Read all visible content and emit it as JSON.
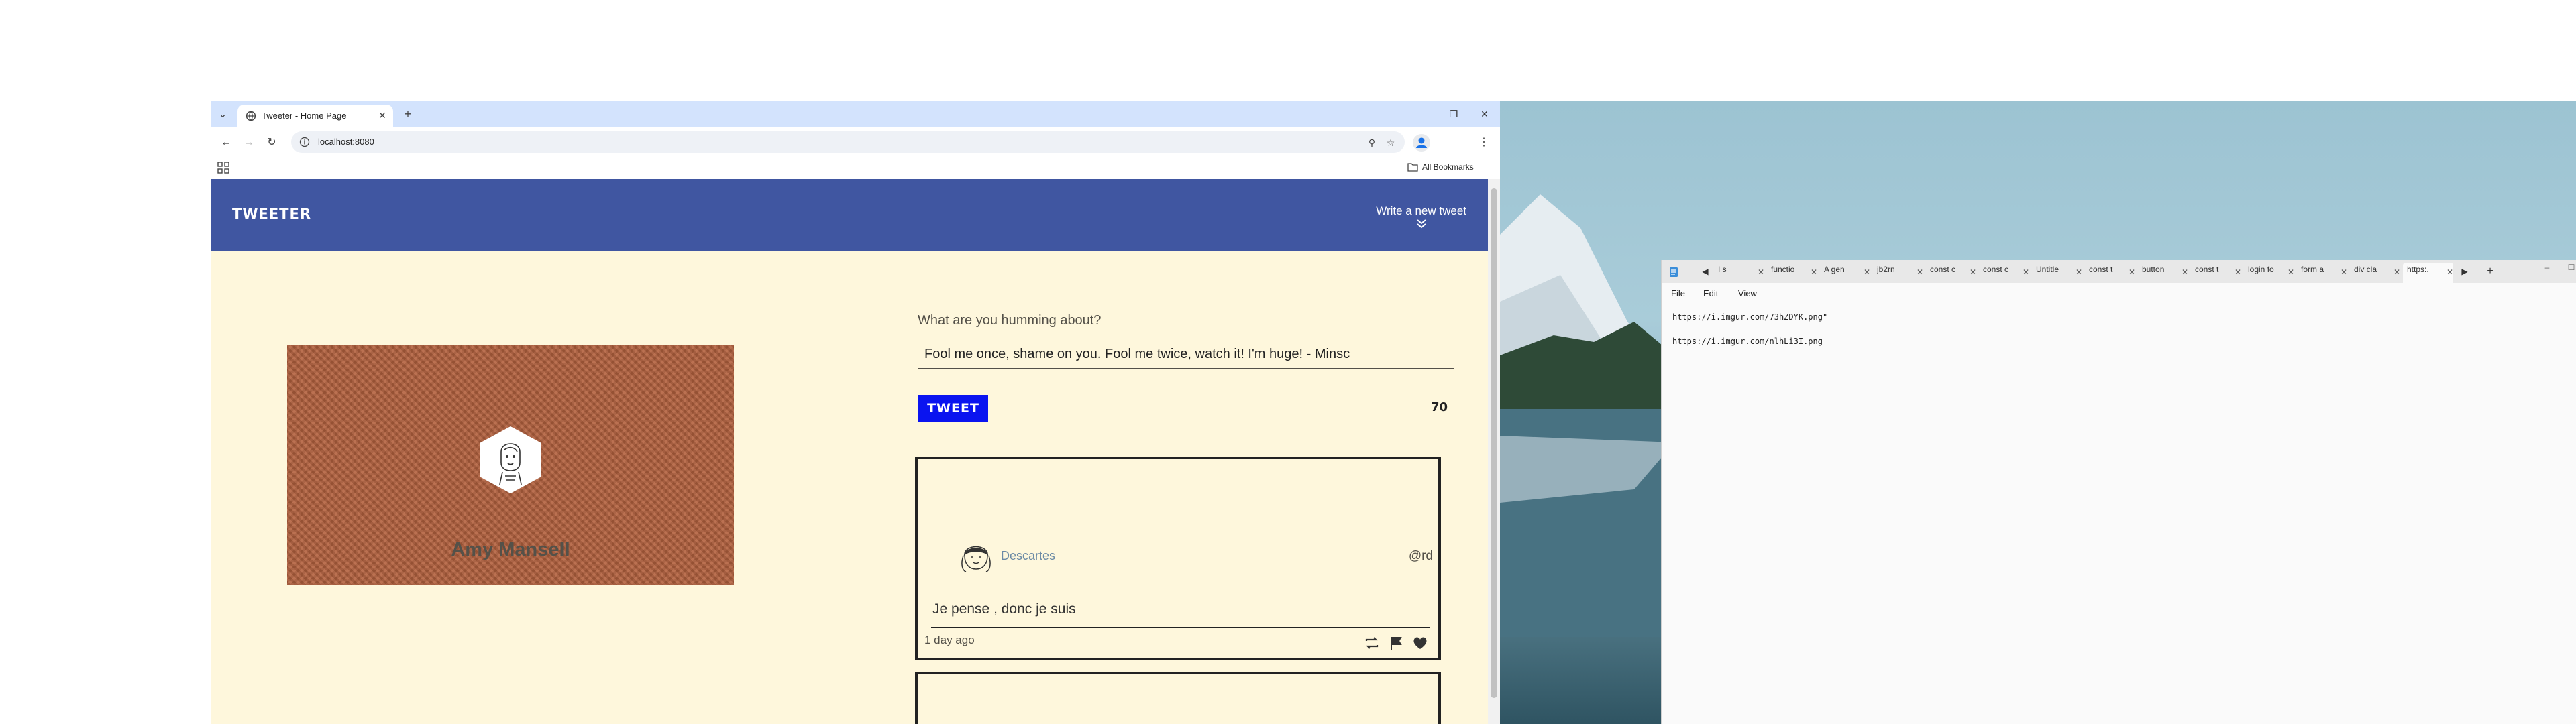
{
  "browser": {
    "tab_title": "Tweeter - Home Page",
    "url": "localhost:8080",
    "bookmarks_label": "All Bookmarks"
  },
  "site": {
    "logo": "TWEETER",
    "write_link": "Write a new tweet"
  },
  "profile": {
    "name": "Amy Mansell"
  },
  "compose": {
    "label": "What are you humming about?",
    "text": "Fool me once, shame on you. Fool me twice, watch it! I'm huge! - Minsc",
    "button": "TWEET",
    "counter": "70"
  },
  "tweet": {
    "author": "Descartes",
    "handle": "@rd",
    "text": "Je pense , donc je suis",
    "time": "1 day ago"
  },
  "editor": {
    "tabs": [
      "I s",
      "functio",
      "A gen",
      "jb2rn",
      "const c",
      "const c",
      "Untitle",
      "const t",
      "button",
      "const t",
      "login fo",
      "form a",
      "div cla",
      "https:."
    ],
    "active_tab_index": 13,
    "menu": [
      "File",
      "Edit",
      "View"
    ],
    "lines": [
      "https://i.imgur.com/73hZDYK.png\"",
      "https://i.imgur.com/nlhLi3I.png"
    ]
  }
}
